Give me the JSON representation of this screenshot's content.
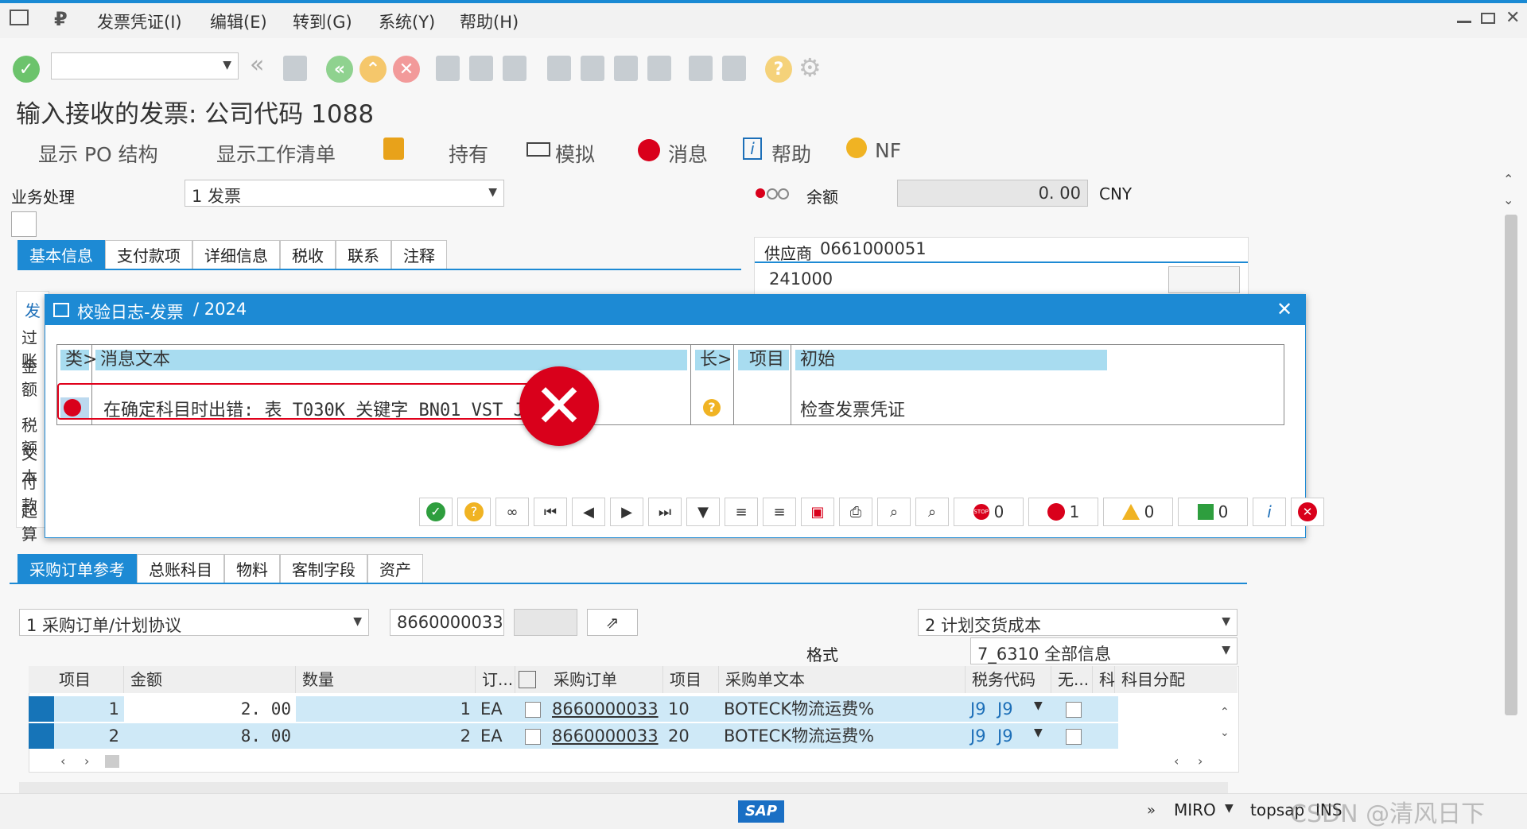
{
  "menu": {
    "items": [
      "发票凭证(I)",
      "编辑(E)",
      "转到(G)",
      "系统(Y)",
      "帮助(H)"
    ]
  },
  "page_title": "输入接收的发票: 公司代码 1088",
  "actions": {
    "po_structure": "显示 PO 结构",
    "worklist": "显示工作清单",
    "hold": "持有",
    "simulate": "模拟",
    "messages": "消息",
    "help": "帮助",
    "nf": "NF"
  },
  "header": {
    "transaction_label": "业务处理",
    "transaction_value": "1 发票",
    "balance_label": "余额",
    "balance_value": "0. 00",
    "currency": "CNY",
    "vendor_label": "供应商",
    "vendor_value": "0661000051",
    "vendor_line2": "241000"
  },
  "tabs_top": [
    "基本信息",
    "支付款项",
    "详细信息",
    "税收",
    "联系",
    "注释"
  ],
  "left_labels": [
    "发",
    "过账",
    "金额",
    "税额",
    "文本",
    "付款",
    "起算"
  ],
  "dialog": {
    "title": "校验日志-发票",
    "title_suffix": "/ 2024",
    "columns": [
      "类>",
      "消息文本",
      "长>",
      "项目",
      "初始"
    ],
    "rows": [
      {
        "text": "在确定科目时出错: 表 T030K 关键字 BN01 VST J9 CN",
        "item": "",
        "origin": "检查发票凭证"
      }
    ],
    "counts": {
      "stop": "0",
      "error": "1",
      "warning": "0",
      "success": "0"
    }
  },
  "tabs_bottom": [
    "采购订单参考",
    "总账科目",
    "物料",
    "客制字段",
    "资产"
  ],
  "po_ref": {
    "type_value": "1 采购订单/计划协议",
    "po_number": "8660000033",
    "cost_type": "2 计划交货成本",
    "layout_label": "格式",
    "layout_value": "7_6310 全部信息"
  },
  "table": {
    "headers": [
      "项目",
      "金额",
      "数量",
      "订...",
      "采购订单",
      "项目",
      "采购单文本",
      "税务代码",
      "无...",
      "科",
      "科目分配"
    ],
    "rows": [
      {
        "item": "1",
        "amount": "2. 00",
        "qty": "1",
        "unit": "EA",
        "po": "8660000033",
        "po_item": "10",
        "text": "BOTECK物流运费%",
        "tax1": "J9",
        "tax2": "J9"
      },
      {
        "item": "2",
        "amount": "8. 00",
        "qty": "2",
        "unit": "EA",
        "po": "8660000033",
        "po_item": "20",
        "text": "BOTECK物流运费%",
        "tax1": "J9",
        "tax2": "J9"
      }
    ]
  },
  "status": {
    "client": "MIRO",
    "server": "topsap",
    "mode": "INS",
    "watermark": "CSDN @清风日下"
  },
  "colors": {
    "accent": "#1d8ad4",
    "error": "#d9001b",
    "selected_row": "#cfe9f7"
  }
}
